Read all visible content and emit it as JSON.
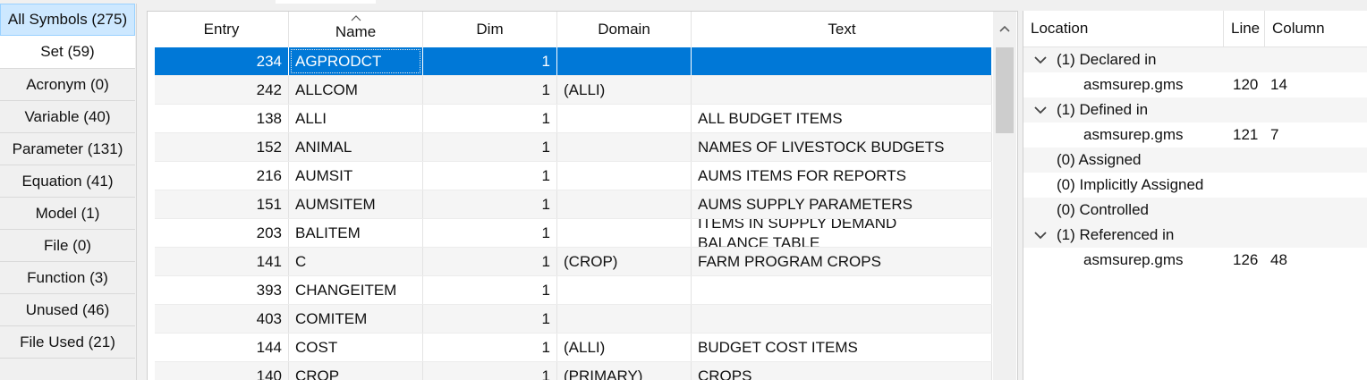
{
  "symbol_tabs": [
    {
      "label": "All Symbols (275)"
    },
    {
      "label": "Set (59)"
    },
    {
      "label": "Acronym (0)"
    },
    {
      "label": "Variable (40)"
    },
    {
      "label": "Parameter (131)"
    },
    {
      "label": "Equation (41)"
    },
    {
      "label": "Model (1)"
    },
    {
      "label": "File (0)"
    },
    {
      "label": "Function (3)"
    },
    {
      "label": "Unused (46)"
    },
    {
      "label": "File Used (21)"
    }
  ],
  "symbol_table": {
    "columns": [
      "Entry",
      "Name",
      "Dim",
      "Domain",
      "Text"
    ],
    "sorted_column": "Name",
    "rows": [
      {
        "entry": "234",
        "name": "AGPRODCT",
        "dim": "1",
        "domain": "",
        "text": "",
        "selected": true
      },
      {
        "entry": "242",
        "name": "ALLCOM",
        "dim": "1",
        "domain": "(ALLI)",
        "text": ""
      },
      {
        "entry": "138",
        "name": "ALLI",
        "dim": "1",
        "domain": "",
        "text": "ALL BUDGET ITEMS"
      },
      {
        "entry": "152",
        "name": "ANIMAL",
        "dim": "1",
        "domain": "",
        "text": "NAMES OF LIVESTOCK BUDGETS"
      },
      {
        "entry": "216",
        "name": "AUMSIT",
        "dim": "1",
        "domain": "",
        "text": "AUMS ITEMS FOR REPORTS"
      },
      {
        "entry": "151",
        "name": "AUMSITEM",
        "dim": "1",
        "domain": "",
        "text": "AUMS SUPPLY PARAMETERS"
      },
      {
        "entry": "203",
        "name": "BALITEM",
        "dim": "1",
        "domain": "",
        "text": "ITEMS IN SUPPLY DEMAND BALANCE TABLE"
      },
      {
        "entry": "141",
        "name": "C",
        "dim": "1",
        "domain": "(CROP)",
        "text": "FARM PROGRAM CROPS"
      },
      {
        "entry": "393",
        "name": "CHANGEITEM",
        "dim": "1",
        "domain": "",
        "text": ""
      },
      {
        "entry": "403",
        "name": "COMITEM",
        "dim": "1",
        "domain": "",
        "text": ""
      },
      {
        "entry": "144",
        "name": "COST",
        "dim": "1",
        "domain": "(ALLI)",
        "text": "BUDGET COST ITEMS"
      },
      {
        "entry": "140",
        "name": "CROP",
        "dim": "1",
        "domain": "(PRIMARY)",
        "text": "CROPS"
      }
    ]
  },
  "reference_panel": {
    "columns": [
      "Location",
      "Line",
      "Column"
    ],
    "rows": [
      {
        "label": "(1) Declared in",
        "expanded": true,
        "line": "",
        "column": ""
      },
      {
        "label": "asmsurep.gms",
        "child": true,
        "line": "120",
        "column": "14"
      },
      {
        "label": "(1) Defined in",
        "expanded": true,
        "line": "",
        "column": ""
      },
      {
        "label": "asmsurep.gms",
        "child": true,
        "line": "121",
        "column": "7"
      },
      {
        "label": "(0) Assigned",
        "line": "",
        "column": ""
      },
      {
        "label": "(0) Implicitly Assigned",
        "line": "",
        "column": ""
      },
      {
        "label": "(0) Controlled",
        "line": "",
        "column": ""
      },
      {
        "label": "(1) Referenced in",
        "expanded": true,
        "line": "",
        "column": ""
      },
      {
        "label": "asmsurep.gms",
        "child": true,
        "line": "126",
        "column": "48"
      }
    ]
  },
  "icons": {
    "sort": "sort-ascending-icon",
    "scroll_up": "scroll-up-arrow-icon",
    "expand": "chevron-down-icon"
  },
  "colors": {
    "selection": "#0078d7",
    "active_tab": "#cde8ff"
  }
}
